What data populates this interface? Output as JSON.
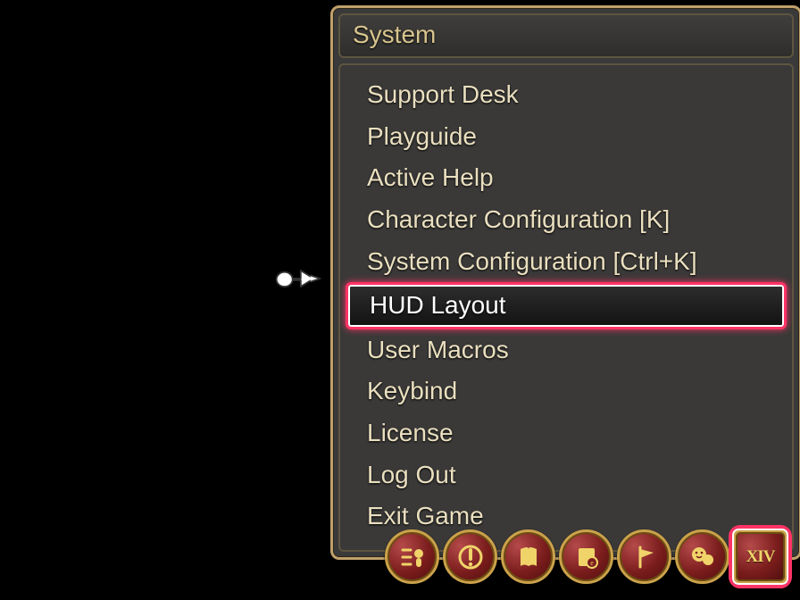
{
  "menu": {
    "title": "System",
    "items": [
      {
        "label": "Support Desk"
      },
      {
        "label": "Playguide"
      },
      {
        "label": "Active Help"
      },
      {
        "label": "Character Configuration [K]"
      },
      {
        "label": "System Configuration [Ctrl+K]"
      },
      {
        "label": "HUD Layout",
        "selected": true
      },
      {
        "label": "User Macros"
      },
      {
        "label": "Keybind"
      },
      {
        "label": "License"
      },
      {
        "label": "Log Out"
      },
      {
        "label": "Exit Game"
      }
    ]
  },
  "tray": {
    "buttons": [
      {
        "name": "duty-finder-icon"
      },
      {
        "name": "notice-icon"
      },
      {
        "name": "journal-icon"
      },
      {
        "name": "handbook-icon"
      },
      {
        "name": "flag-icon"
      },
      {
        "name": "social-icon"
      },
      {
        "name": "system-icon",
        "selected": true,
        "text": "XIV"
      }
    ]
  }
}
